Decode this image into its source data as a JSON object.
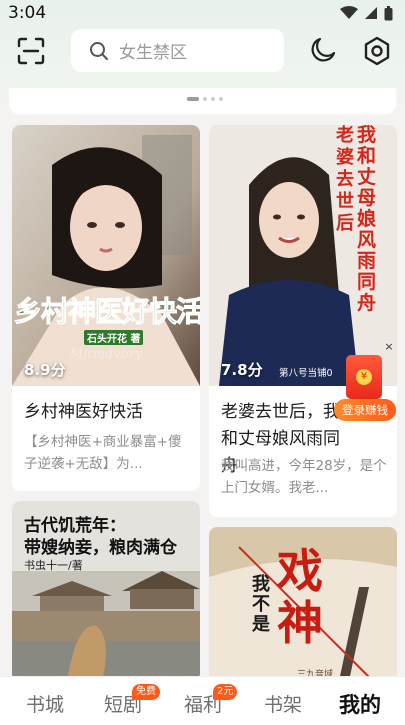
{
  "status_bar": {
    "time": "3:04",
    "icons": [
      "wifi-icon",
      "signal-icon",
      "battery-icon"
    ]
  },
  "topbar": {
    "search_placeholder": "女生禁区",
    "icons": [
      "scan-icon",
      "search-icon",
      "moon-icon",
      "gear-icon"
    ]
  },
  "books": [
    {
      "score": "8.9分",
      "title": "乡村神医好快活",
      "description": "【乡村神医+商业暴富+傻子逆袭+无敌】为...",
      "cover_title": "乡村神医好快活",
      "cover_author": "石头开花 著",
      "cover_sign": "Mjtmdvbry"
    },
    {
      "score": "7.8分",
      "title": "老婆去世后，我和丈母娘风雨同舟",
      "description": "我叫高进，今年28岁，是个上门女婿。我老...",
      "cover_title_right": "我和丈母娘风雨同舟",
      "cover_title_left": "老婆去世后",
      "cover_author": "第八号当铺0"
    },
    {
      "cover_title_line1": "古代饥荒年：",
      "cover_title_line2": "带嫂纳妾，粮肉满仓",
      "cover_author": "书虫十一/著"
    },
    {
      "cover_title_big": "戏神",
      "cover_title_small": "我不是",
      "cover_author": "三九音域"
    }
  ],
  "floating_reward": {
    "label": "登录赚钱",
    "close": "×"
  },
  "bottom_nav": [
    {
      "label": "书城",
      "active": false
    },
    {
      "label": "短剧",
      "badge": "免费",
      "active": false
    },
    {
      "label": "福利",
      "badge": "2元",
      "active": false
    },
    {
      "label": "书架",
      "active": false
    },
    {
      "label": "我的",
      "active": true
    }
  ],
  "colors": {
    "accent": "#ff5a1a",
    "header_tint": "#e8f2ea",
    "background": "#f4f3f1"
  }
}
